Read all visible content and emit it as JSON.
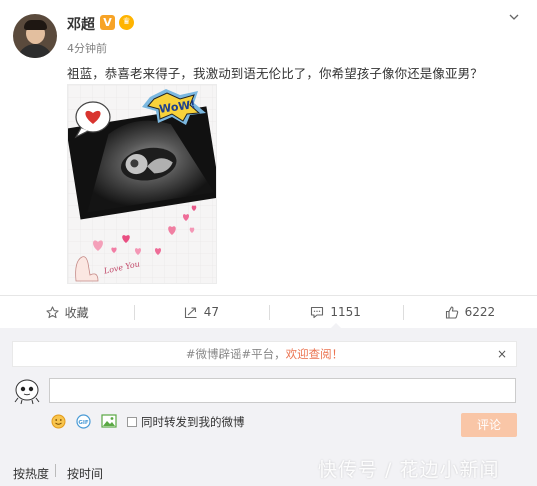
{
  "post": {
    "username": "邓超",
    "verified_badge": "V",
    "timestamp": "4分钟前",
    "text": "祖蓝，恭喜老来得子，我激动到语无伦比了，你希望孩子像你还是像亚男？",
    "image": {
      "subject": "ultrasound photo with stickers",
      "sticker_text": "WoW!",
      "caption_text": "Love You"
    }
  },
  "actions": {
    "favorite_label": "收藏",
    "repost_count": "47",
    "comment_count": "1151",
    "like_count": "6222"
  },
  "comment_box": {
    "notice_prefix": "#微博辟谣#平台，",
    "notice_highlight": "欢迎查阅！",
    "close_label": "×",
    "input_value": "",
    "repost_option_label": "同时转发到我的微博",
    "submit_label": "评论"
  },
  "sort": {
    "hot_label": "按热度",
    "time_label": "按时间"
  },
  "watermark": "快传号 / 花边小新闻",
  "colors": {
    "accent": "#eb7350",
    "submit_bg": "#f9c6a7",
    "panel_bg": "#f2f2f5",
    "verified": "#f7a326"
  },
  "icons": [
    "chevron-down-icon",
    "star-icon",
    "repost-icon",
    "comment-icon",
    "like-icon",
    "emoji-icon",
    "gif-icon",
    "image-icon"
  ]
}
